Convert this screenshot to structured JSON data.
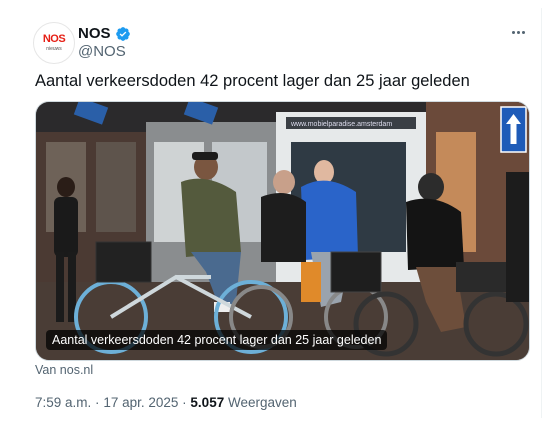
{
  "author": {
    "name": "NOS",
    "handle": "@NOS",
    "avatar_text": "NOS",
    "avatar_subtext": "nieuws",
    "verified_color": "#1d9bf0",
    "brand_color": "#e61e14"
  },
  "tweet": {
    "text": "Aantal verkeersdoden 42 procent lager dan 25 jaar geleden"
  },
  "media": {
    "caption": "Aantal verkeersdoden 42 procent lager dan 25 jaar geleden",
    "storefront_text": "www.mobielparadise.amsterdam"
  },
  "card_source": "Van nos.nl",
  "meta": {
    "time": "7:59 a.m.",
    "separator": "·",
    "date": "17 apr. 2025",
    "views_count": "5.057",
    "views_label": "Weergaven"
  },
  "icons": {
    "more": "more-horizontal-icon",
    "verified": "verified-badge-icon",
    "road_sign": "one-way-arrow-sign"
  }
}
